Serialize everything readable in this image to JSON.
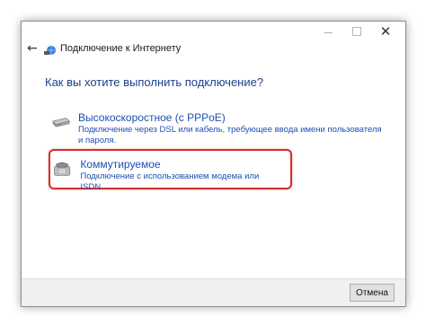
{
  "window": {
    "title": "Подключение к Интернету",
    "controls": {
      "minimize": "—",
      "maximize": "☐",
      "close": "✕"
    },
    "back_icon": "←"
  },
  "main": {
    "heading": "Как вы хотите выполнить подключение?",
    "options": [
      {
        "title": "Высокоскоростное (с PPPoE)",
        "description": "Подключение через DSL или кабель, требующее ввода имени пользователя и пароля.",
        "icon": "modem-icon"
      },
      {
        "title": "Коммутируемое",
        "description": "Подключение с использованием модема или ISDN.",
        "icon": "dialup-phone-icon",
        "highlighted": true
      }
    ]
  },
  "footer": {
    "cancel_label": "Отмена"
  },
  "colors": {
    "link": "#1d4fb0",
    "heading": "#1d3f8c",
    "highlight": "#d32f2f"
  }
}
